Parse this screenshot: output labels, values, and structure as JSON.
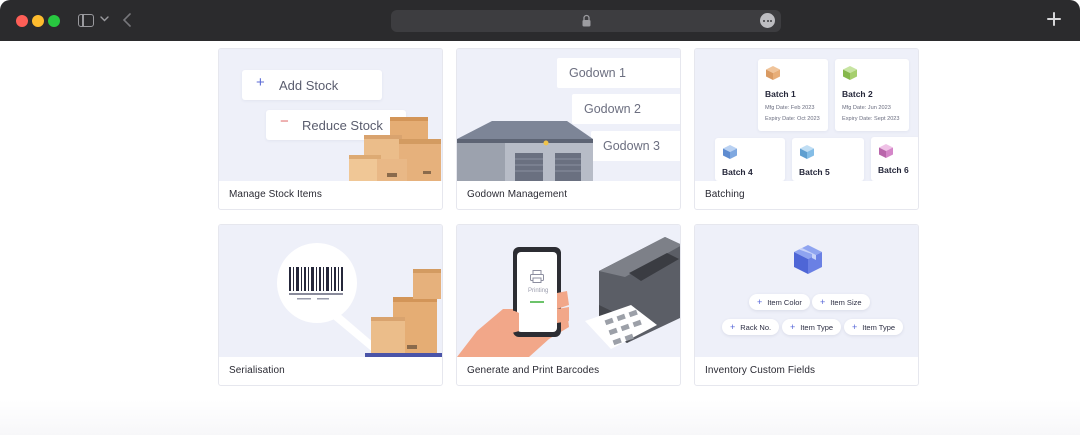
{
  "browser": {
    "icons": [
      "close-dot",
      "minimize-dot",
      "zoom-dot",
      "sidebar-icon",
      "chevron-down-icon",
      "back-arrow-icon",
      "lock-icon",
      "more-icon",
      "plus-icon"
    ]
  },
  "cards": [
    {
      "caption": "Manage Stock Items",
      "add_label": "Add Stock",
      "reduce_label": "Reduce Stock",
      "add_symbol": "+",
      "reduce_symbol": "−"
    },
    {
      "caption": "Godown Management",
      "godowns": [
        "Godown 1",
        "Godown 2",
        "Godown 3"
      ]
    },
    {
      "caption": "Batching",
      "batches": [
        {
          "name": "Batch 1",
          "mfg": "Mfg Date: Feb 2023",
          "expiry": "Expiry Date: Oct 2023",
          "color": "#e8a874"
        },
        {
          "name": "Batch 2",
          "mfg": "Mfg Date: Jun 2023",
          "expiry": "Expiry Date: Sept 2023",
          "color": "#a6cf6e"
        },
        {
          "name": "Batch 4",
          "color": "#7fa8e0"
        },
        {
          "name": "Batch 5",
          "color": "#84bde6"
        },
        {
          "name": "Batch 6",
          "color": "#d486c8"
        }
      ]
    },
    {
      "caption": "Serialisation"
    },
    {
      "caption": "Generate and Print Barcodes",
      "phone_label": "Printing"
    },
    {
      "caption": "Inventory Custom Fields",
      "fields": [
        "Item Color",
        "Item Size",
        "Rack No.",
        "Item Type",
        "Item Type"
      ],
      "field_symbol": "+"
    }
  ],
  "colors": {
    "accent": "#5c6bd6",
    "chrome": "#2b2b2d",
    "illustration_bg": "#eef0f9",
    "box": "#e7b47f"
  }
}
